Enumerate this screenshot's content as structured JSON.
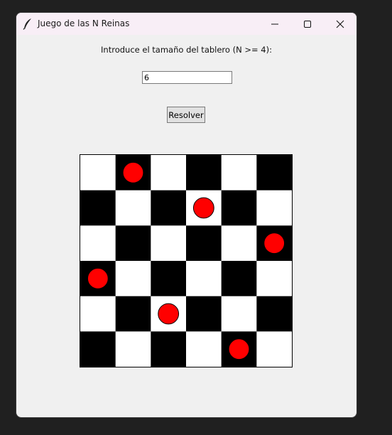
{
  "window": {
    "title": "Juego de las N Reinas",
    "icon": "feather-icon",
    "controls": [
      "minimize-icon",
      "maximize-icon",
      "close-icon"
    ]
  },
  "form": {
    "prompt": "Introduce el tamaño del tablero (N >= 4):",
    "size_value": "6",
    "solve_label": "Resolver"
  },
  "board": {
    "n": 6,
    "queens_col_by_row": [
      1,
      3,
      5,
      0,
      2,
      4
    ],
    "colors": {
      "light": "#ffffff",
      "dark": "#000000",
      "queen": "#ff0000",
      "queen_outline": "#000000"
    }
  }
}
